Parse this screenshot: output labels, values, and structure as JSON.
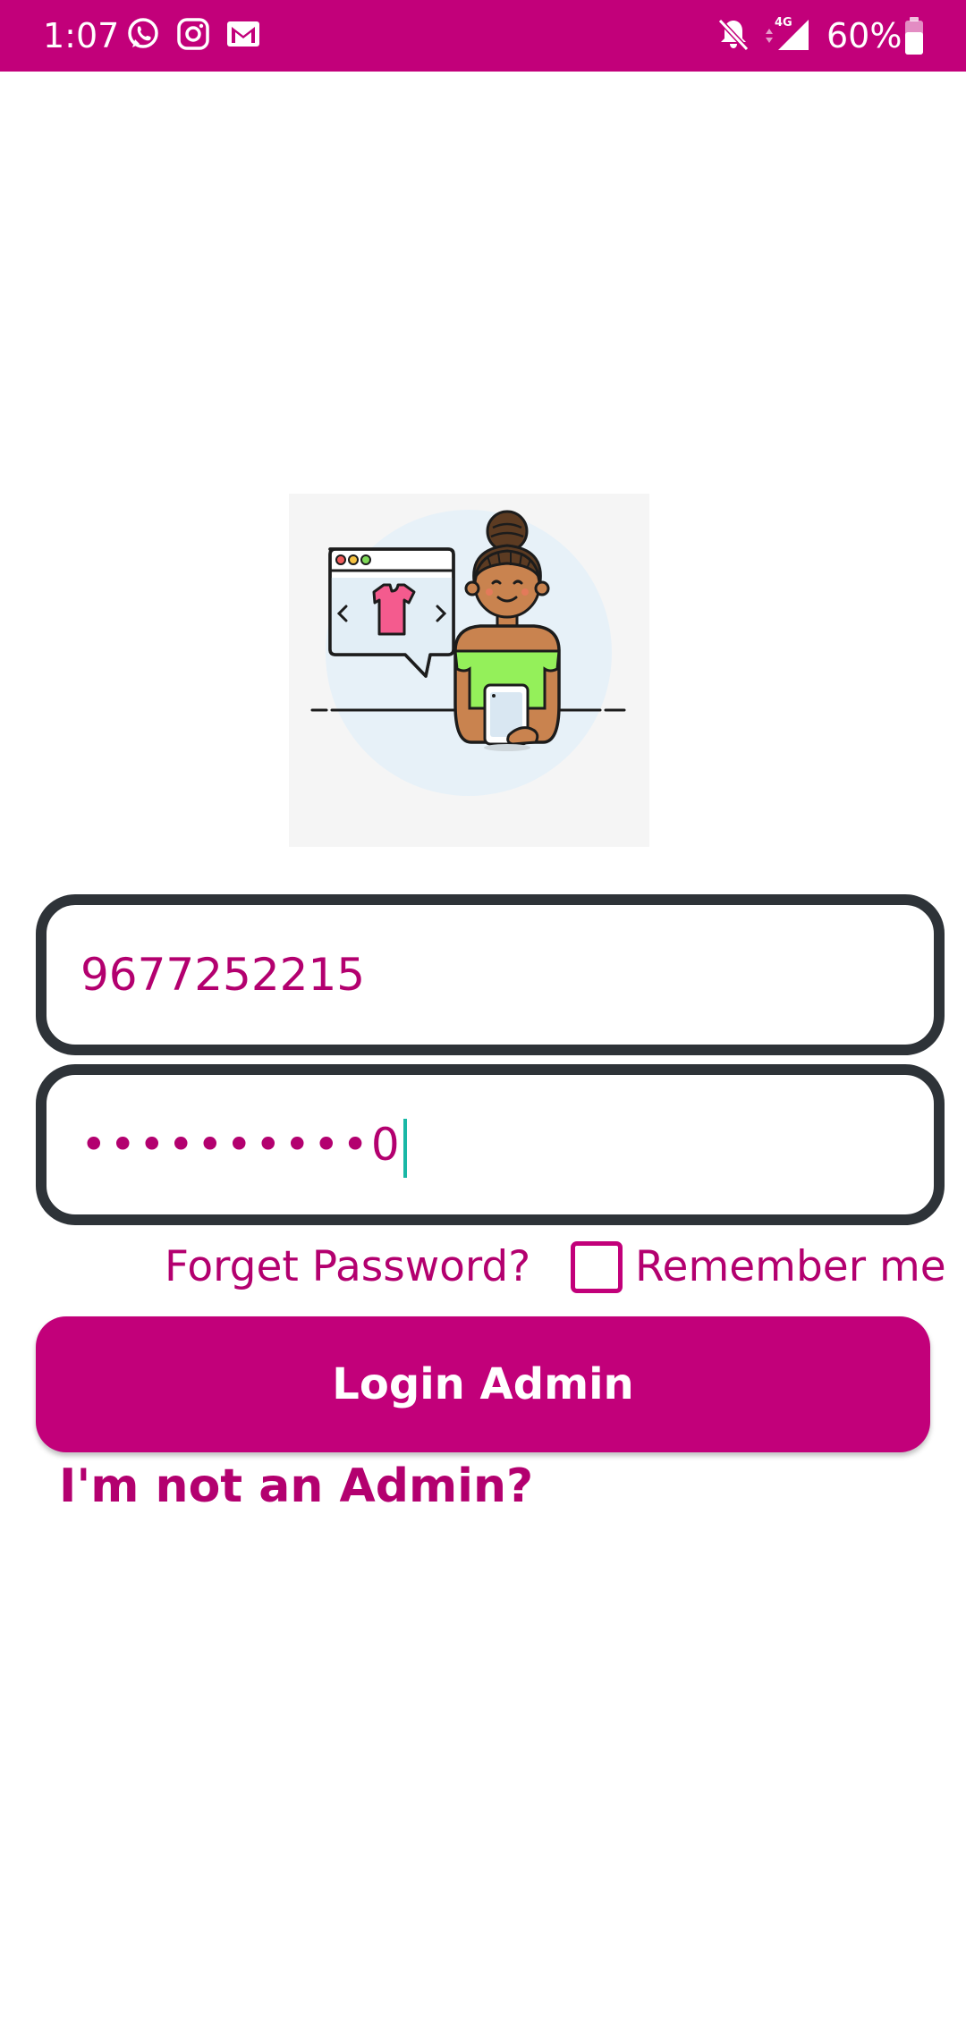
{
  "status_bar": {
    "time": "1:07",
    "battery": "60%",
    "network": "4G",
    "background_color": "#c2007a",
    "left_icons": [
      "whatsapp-icon",
      "instagram-icon",
      "gmail-icon"
    ],
    "right_icons": [
      "notifications-off-icon",
      "signal-icon",
      "battery-icon"
    ]
  },
  "illustration": {
    "icon": "shopping-woman-illustration"
  },
  "login_form": {
    "phone_value": "9677252215",
    "password_value": "••••••••••0",
    "forget_password_label": "Forget Password?",
    "remember_me_label": "Remember me",
    "remember_me_checked": false,
    "login_button_label": "Login Admin",
    "not_admin_label": "I'm not an Admin?"
  },
  "colors": {
    "accent": "#c2007a",
    "text_accent": "#b3006f",
    "input_border": "#2e3338",
    "caret": "#19b8a6"
  }
}
